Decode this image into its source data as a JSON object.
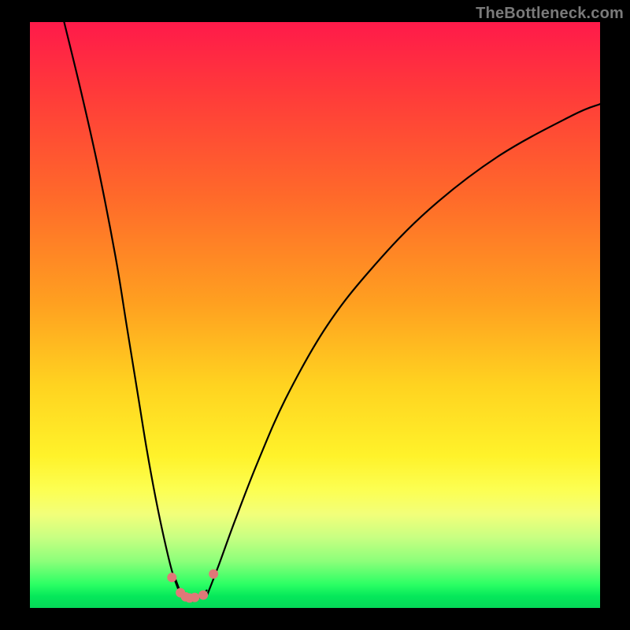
{
  "attribution": "TheBottleneck.com",
  "chart_data": {
    "type": "line",
    "title": "",
    "xlabel": "",
    "ylabel": "",
    "xlim": [
      0,
      100
    ],
    "ylim": [
      0,
      100
    ],
    "curve_left": {
      "x": [
        6,
        9,
        12,
        15,
        17,
        19,
        20.5,
        22,
        23.5,
        25,
        26.5
      ],
      "y": [
        100,
        88,
        75,
        60,
        48,
        36,
        27,
        19,
        12,
        6,
        2
      ]
    },
    "curve_right": {
      "x": [
        31,
        33,
        36,
        40,
        45,
        52,
        60,
        70,
        82,
        95,
        100
      ],
      "y": [
        2,
        7,
        15,
        25,
        36,
        48,
        58,
        68,
        77,
        84,
        86
      ]
    },
    "trough": {
      "x": [
        25.5,
        26.5,
        27.3,
        28,
        28.5,
        29,
        30,
        31
      ],
      "y": [
        5,
        2.5,
        1.5,
        1.2,
        1.2,
        1.4,
        2,
        3
      ]
    },
    "dots": {
      "x": [
        24.9,
        26.4,
        27.3,
        28.0,
        28.9,
        30.4,
        32.2
      ],
      "y": [
        5.2,
        2.6,
        1.9,
        1.7,
        1.8,
        2.2,
        5.8
      ],
      "color": "#e07878",
      "radius": 6
    },
    "gradient_stops": [
      {
        "pos": 0,
        "color": "#ff1a4a"
      },
      {
        "pos": 12,
        "color": "#ff3a3a"
      },
      {
        "pos": 30,
        "color": "#ff6a2a"
      },
      {
        "pos": 48,
        "color": "#ffa020"
      },
      {
        "pos": 62,
        "color": "#ffd320"
      },
      {
        "pos": 74,
        "color": "#fff22a"
      },
      {
        "pos": 80,
        "color": "#fcff53"
      },
      {
        "pos": 84,
        "color": "#f2ff7a"
      },
      {
        "pos": 88,
        "color": "#c8ff82"
      },
      {
        "pos": 92,
        "color": "#8cff7a"
      },
      {
        "pos": 96,
        "color": "#2bff64"
      },
      {
        "pos": 98,
        "color": "#05e85a"
      },
      {
        "pos": 100,
        "color": "#05d858"
      }
    ]
  }
}
